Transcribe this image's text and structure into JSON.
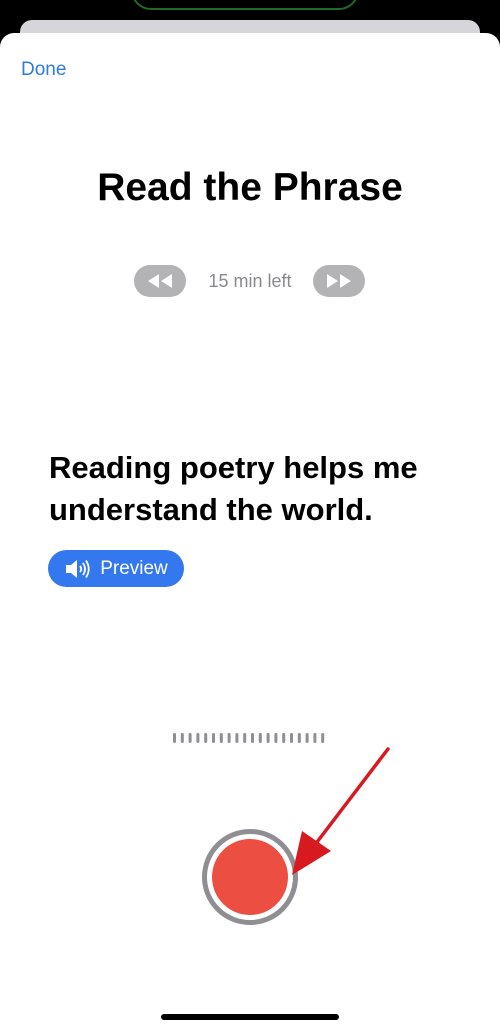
{
  "header": {
    "done_label": "Done"
  },
  "title": "Read the Phrase",
  "timer": {
    "time_left": "15 min left",
    "back_icon": "rewind-icon",
    "forward_icon": "fast-forward-icon"
  },
  "phrase": "Reading poetry helps me understand the world.",
  "preview": {
    "label": "Preview",
    "icon": "speaker-icon"
  },
  "record": {
    "icon": "record-icon"
  },
  "colors": {
    "accent": "#2f7be0",
    "preview_button": "#3478f0",
    "record": "#ec4e41",
    "skip_button": "#b3b3b6",
    "annotation_arrow": "#d71920"
  }
}
